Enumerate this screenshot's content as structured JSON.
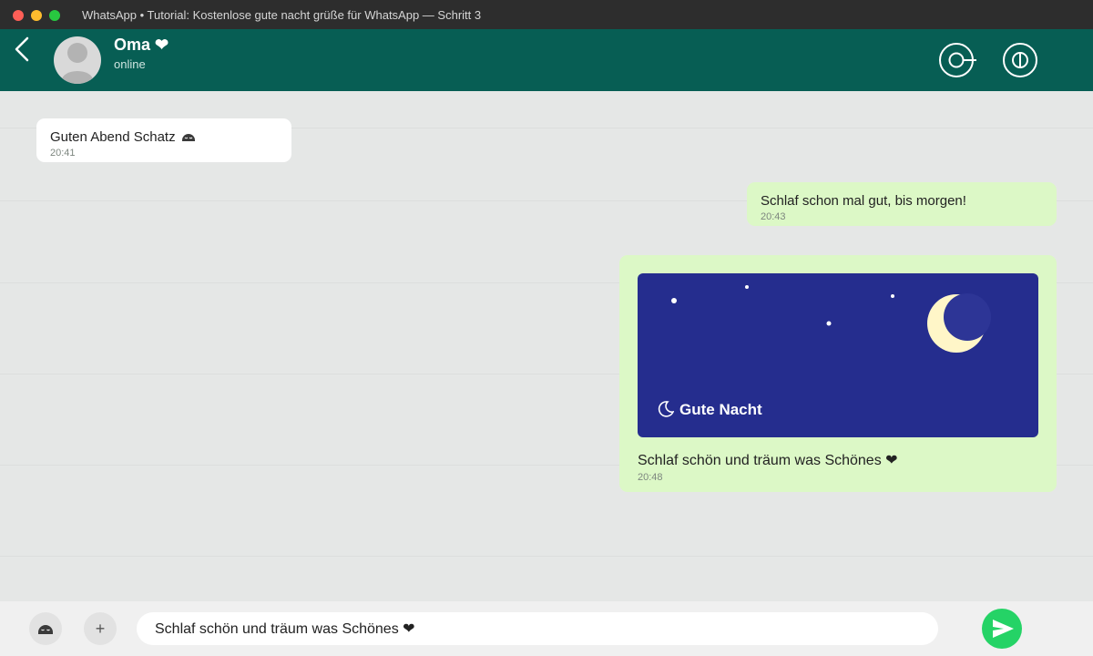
{
  "window": {
    "title": "WhatsApp • Tutorial: Kostenlose gute nacht grüße für WhatsApp — Schritt 3"
  },
  "header": {
    "contact_name": "Oma ❤",
    "status": "online",
    "icons": [
      "back-arrow-icon",
      "avatar",
      "call-icon",
      "info-icon"
    ]
  },
  "messages": [
    {
      "direction": "in",
      "text": "Guten Abend Schatz",
      "time": "20:41"
    },
    {
      "direction": "out",
      "text": "Schlaf schon mal gut, bis morgen!",
      "time": "20:43"
    },
    {
      "direction": "out",
      "type": "image",
      "card_label": "Gute Nacht",
      "caption": "Schlaf schön und träum was Schönes ❤",
      "time": "20:48"
    }
  ],
  "composer": {
    "value": "Schlaf schön und träum was Schönes ❤",
    "attach_label": "+"
  },
  "colors": {
    "header": "#075e54",
    "outgoing_bubble": "#dcf8c6",
    "incoming_bubble": "#ffffff",
    "night_card": "#252d8e",
    "moon": "#fff6c8",
    "send_button": "#25d366"
  }
}
